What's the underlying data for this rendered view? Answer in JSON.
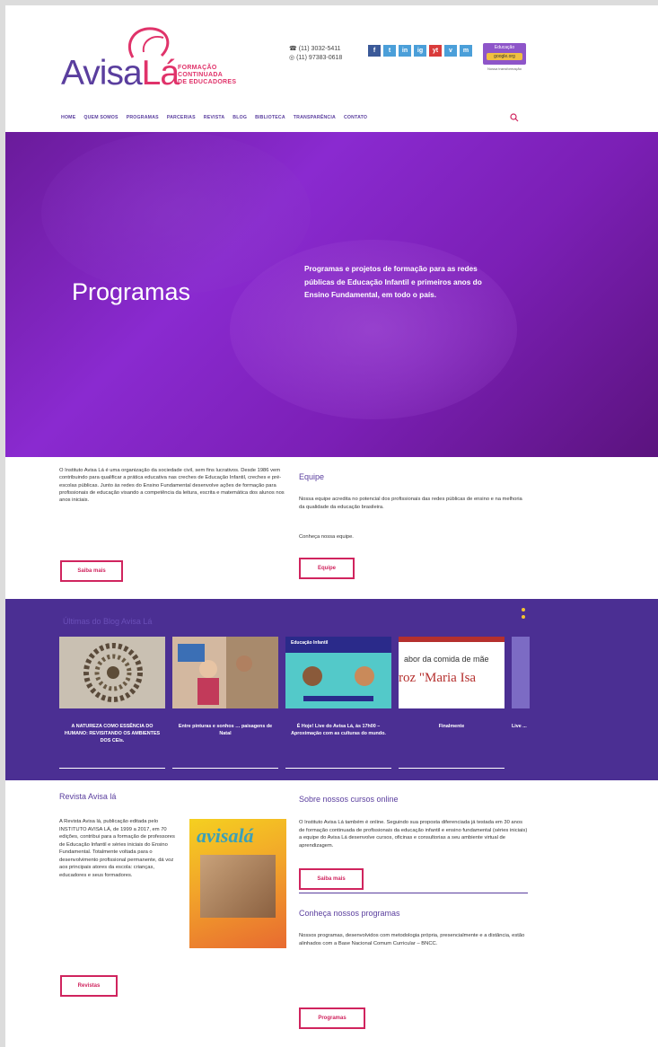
{
  "header": {
    "logo_word": "Avisa",
    "logo_la": "Lá",
    "logo_sub": [
      "FORMAÇÃO",
      "CONTINUADA",
      "DE EDUCADORES"
    ],
    "phone1": "(11) 3032-5411",
    "phone2": "(11) 97383-0618",
    "socials": [
      "f",
      "t",
      "in",
      "ig",
      "yt",
      "v",
      "m"
    ],
    "badge_title": "Educação",
    "badge_label": "google.org",
    "badge_caption": "Nossa transformação"
  },
  "nav": [
    "HOME",
    "QUEM SOMOS",
    "PROGRAMAS",
    "PARCERIAS",
    "REVISTA",
    "BLOG",
    "BIBLIOTECA",
    "TRANSPARÊNCIA",
    "CONTATO"
  ],
  "hero": {
    "title": "Programas",
    "text": "Programas e projetos de formação para as redes públicas de Educação Infantil e primeiros anos do Ensino Fundamental, em todo o país."
  },
  "intro": {
    "text": "O Instituto Avisa Lá é uma organização da sociedade civil, sem fins lucrativos. Desde 1986 vem contribuindo para qualificar a prática educativa nas creches de Educação Infantil, creches e pré-escolas públicas. Junto às redes do Ensino Fundamental desenvolve ações de formação para profissionais de educação visando a competência da leitura, escrita e matemática dos alunos nos anos iniciais.",
    "button": "Saiba mais"
  },
  "equipe": {
    "title": "Equipe",
    "text": "Nossa equipe acredita no potencial dos profissionais das redes públicas de ensino e na melhoria da qualidade da educação brasileira.",
    "link_text": "Conheça nossa equipe.",
    "button": "Equipe"
  },
  "band": {
    "title": "Últimas do Blog Avisa Lá",
    "cards": [
      {
        "caption": "A NATUREZA COMO ESSÊNCIA DO HUMANO: REVISITANDO OS AMBIENTES DOS CEIs."
      },
      {
        "caption": "Entre pinturas e sonhos … paisagens de Natal"
      },
      {
        "caption": "É Hoje! Live do Avisa Lá, às 17h00 – Aproximação com as culturas do mundo."
      },
      {
        "caption": "Finalmente"
      },
      {
        "caption": "Live ..."
      }
    ],
    "card3_header": "Educação Infantil",
    "card4_text1": "abor da comida de mãe",
    "card4_text2": "roz \"Maria Isa"
  },
  "revista": {
    "title": "Revista Avisa lá",
    "text": "A Revista Avisa lá, publicação editada pelo INSTITUTO AVISA LÁ, de 1999 a 2017, em 70 edições, contribui para a formação de professores de Educação Infantil e séries iniciais do Ensino Fundamental. Totalmente voltada para o desenvolvimento profissional permanente, dá voz aos principais atores da escola: crianças, educadores e seus formadores.",
    "cover_logo": "avisalá",
    "button": "Revistas"
  },
  "cursos": {
    "title": "Sobre nossos cursos online",
    "text": "O Instituto Avisa Lá também é online. Seguindo sua proposta diferenciada já testada em 30 anos de formação continuada de profissionais da educação infantil e ensino fundamental (séries iniciais) a equipe do Avisa Lá desenvolve cursos, oficinas e consultorias a seu ambiente virtual de aprendizagem.",
    "button": "Saiba mais"
  },
  "programas": {
    "title": "Conheça nossos programas",
    "text": "Nossos programas, desenvolvidos com metodologia própria, presencialmente e a distância, estão alinhados com a Base Nacional Comum Curricular – BNCC.",
    "button": "Programas"
  },
  "colors": {
    "purple": "#5a3e9e",
    "pink": "#d0245e",
    "band": "#4b2f93"
  }
}
